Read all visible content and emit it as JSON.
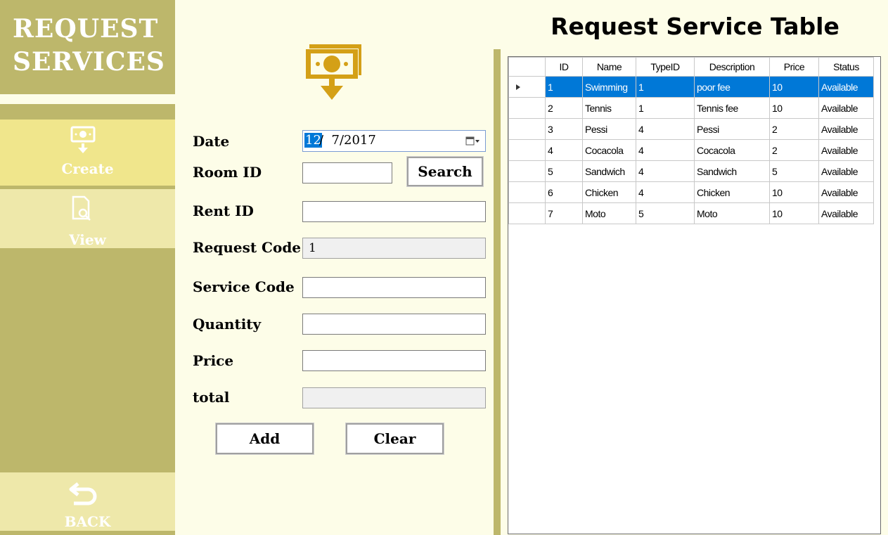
{
  "sidebar": {
    "brand_line1": "REQUEST",
    "brand_line2": "SERVICES",
    "items": [
      {
        "label": "Create",
        "icon": "money-download-icon"
      },
      {
        "label": "View",
        "icon": "document-search-icon"
      },
      {
        "label": "BACK",
        "icon": "back-arrow-icon"
      }
    ]
  },
  "form": {
    "icon": "money-download-icon",
    "date_label": "Date",
    "date_selected": "12",
    "date_rest": "/  7/2017",
    "room_id_label": "Room ID",
    "room_id_value": "",
    "search_label": "Search",
    "rent_id_label": "Rent ID",
    "rent_id_value": "",
    "request_code_label": "Request Code",
    "request_code_value": "1",
    "service_code_label": "Service Code",
    "service_code_value": "",
    "quantity_label": "Quantity",
    "quantity_value": "",
    "price_label": "Price",
    "price_value": "",
    "total_label": "total",
    "total_value": "",
    "add_label": "Add",
    "clear_label": "Clear"
  },
  "table": {
    "title": "Request Service Table",
    "columns": [
      "ID",
      "Name",
      "TypeID",
      "Description",
      "Price",
      "Status"
    ],
    "rows": [
      [
        "1",
        "Swimming",
        "1",
        "poor fee",
        "10",
        "Available"
      ],
      [
        "2",
        "Tennis",
        "1",
        "Tennis fee",
        "10",
        "Available"
      ],
      [
        "3",
        "Pessi",
        "4",
        "Pessi",
        "2",
        "Available"
      ],
      [
        "4",
        "Cocacola",
        "4",
        "Cocacola",
        "2",
        "Available"
      ],
      [
        "5",
        "Sandwich",
        "4",
        "Sandwich",
        "5",
        "Available"
      ],
      [
        "6",
        "Chicken",
        "4",
        "Chicken",
        "10",
        "Available"
      ],
      [
        "7",
        "Moto",
        "5",
        "Moto",
        "10",
        "Available"
      ]
    ],
    "selected_row": 0
  },
  "colors": {
    "sidebar": "#bdb76b",
    "active_item": "#f0e68c",
    "inactive_item": "#eee8aa",
    "background": "#fdfde8",
    "icon_gold": "#d4a017",
    "selection": "#0078d7"
  }
}
